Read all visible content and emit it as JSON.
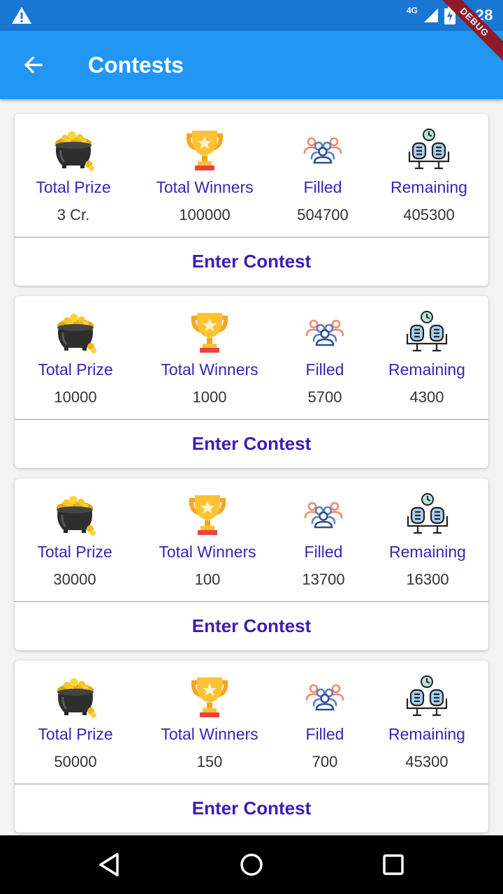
{
  "status_bar": {
    "network": "4G",
    "time": "7:28",
    "debug_label": "DEBUG"
  },
  "app_bar": {
    "title": "Contests",
    "back_icon": "arrow-back-icon"
  },
  "contests": [
    {
      "stats": [
        {
          "label": "Total Prize",
          "value": "3 Cr.",
          "icon": "pot-of-gold-icon"
        },
        {
          "label": "Total Winners",
          "value": "100000",
          "icon": "trophy-icon"
        },
        {
          "label": "Filled",
          "value": "504700",
          "icon": "group-icon"
        },
        {
          "label": "Remaining",
          "value": "405300",
          "icon": "waiting-seats-icon"
        }
      ],
      "action": "Enter Contest"
    },
    {
      "stats": [
        {
          "label": "Total Prize",
          "value": "10000",
          "icon": "pot-of-gold-icon"
        },
        {
          "label": "Total Winners",
          "value": "1000",
          "icon": "trophy-icon"
        },
        {
          "label": "Filled",
          "value": "5700",
          "icon": "group-icon"
        },
        {
          "label": "Remaining",
          "value": "4300",
          "icon": "waiting-seats-icon"
        }
      ],
      "action": "Enter Contest"
    },
    {
      "stats": [
        {
          "label": "Total Prize",
          "value": "30000",
          "icon": "pot-of-gold-icon"
        },
        {
          "label": "Total Winners",
          "value": "100",
          "icon": "trophy-icon"
        },
        {
          "label": "Filled",
          "value": "13700",
          "icon": "group-icon"
        },
        {
          "label": "Remaining",
          "value": "16300",
          "icon": "waiting-seats-icon"
        }
      ],
      "action": "Enter Contest"
    },
    {
      "stats": [
        {
          "label": "Total Prize",
          "value": "50000",
          "icon": "pot-of-gold-icon"
        },
        {
          "label": "Total Winners",
          "value": "150",
          "icon": "trophy-icon"
        },
        {
          "label": "Filled",
          "value": "700",
          "icon": "group-icon"
        },
        {
          "label": "Remaining",
          "value": "45300",
          "icon": "waiting-seats-icon"
        }
      ],
      "action": "Enter Contest"
    }
  ],
  "colors": {
    "app_bar": "#2196f3",
    "status_bar": "#1976d2",
    "label_purple": "#3d22b6",
    "action_purple": "#3d1cb5",
    "background": "#f3f3f3"
  },
  "nav_bar": {
    "back_icon": "nav-back-icon",
    "home_icon": "nav-home-icon",
    "recents_icon": "nav-recents-icon"
  }
}
